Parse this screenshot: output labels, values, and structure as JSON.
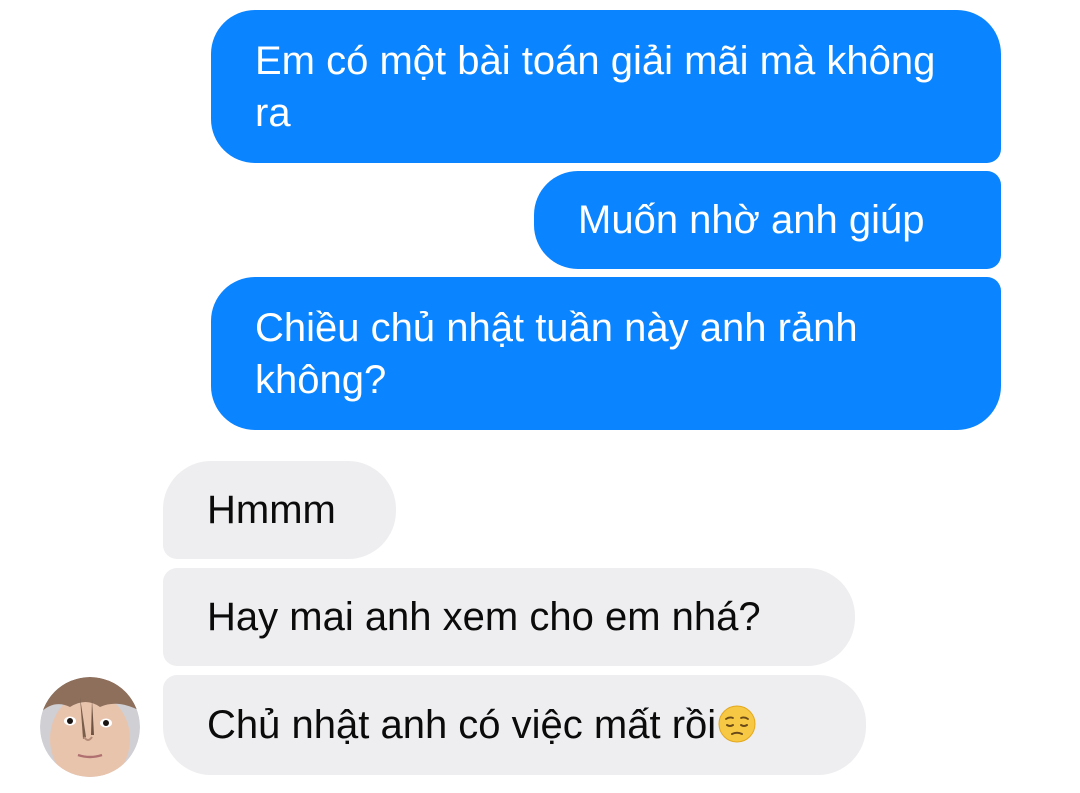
{
  "conversation": {
    "outgoing": [
      {
        "text": "Em có một bài toán giải mãi mà không ra"
      },
      {
        "text": "Muốn nhờ anh giúp"
      },
      {
        "text": "Chiều chủ nhật tuần này anh rảnh không?"
      }
    ],
    "incoming": [
      {
        "text": "Hmmm"
      },
      {
        "text": "Hay mai anh xem cho em nhá?"
      },
      {
        "text": "Chủ nhật anh có việc mất rồi",
        "emoji": "pensive-face-icon"
      }
    ]
  },
  "colors": {
    "outgoing_bubble": "#0a84ff",
    "incoming_bubble": "#eeeef0",
    "outgoing_text": "#ffffff",
    "incoming_text": "#0b0b0b"
  }
}
